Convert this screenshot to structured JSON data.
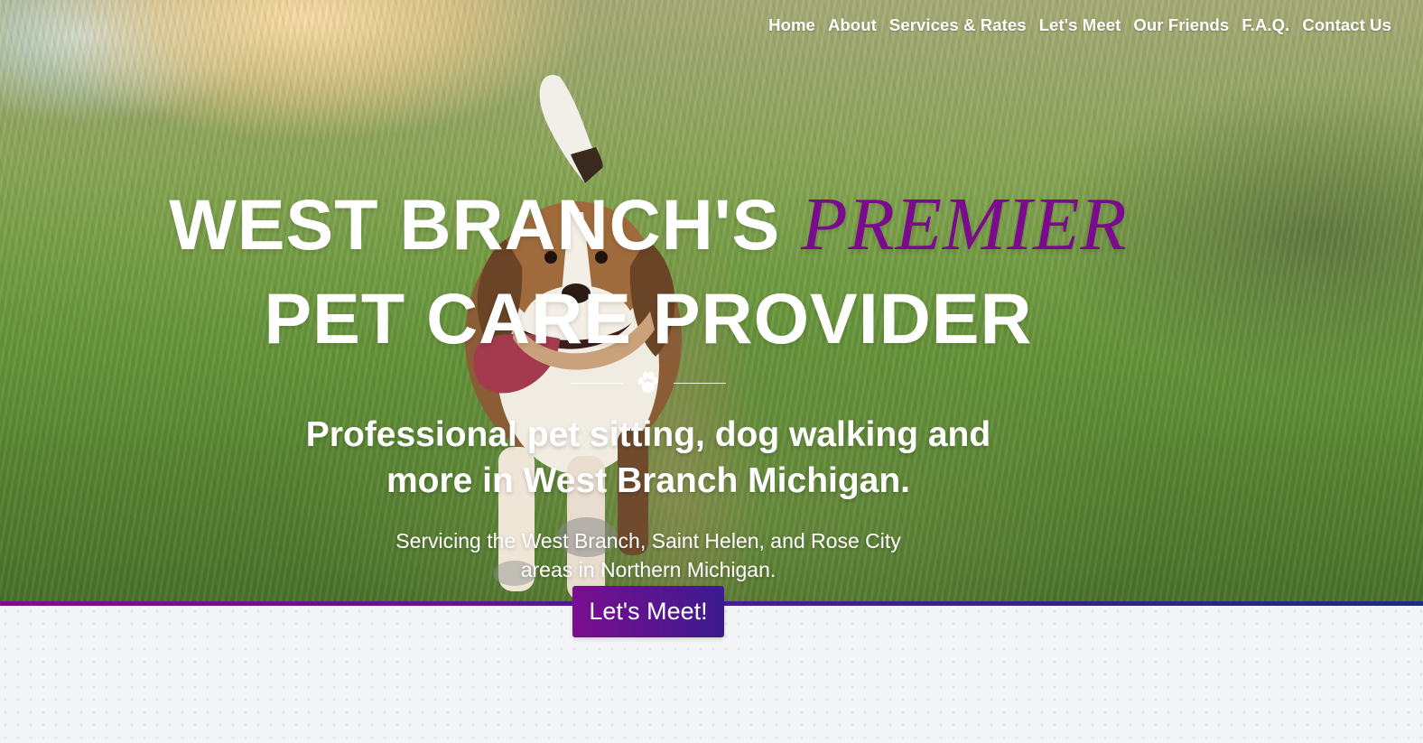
{
  "nav": {
    "items": [
      {
        "label": "Home"
      },
      {
        "label": "About"
      },
      {
        "label": "Services & Rates"
      },
      {
        "label": "Let's Meet"
      },
      {
        "label": "Our Friends"
      },
      {
        "label": "F.A.Q."
      },
      {
        "label": "Contact Us"
      }
    ]
  },
  "hero": {
    "headline_part1": "WEST BRANCH'S ",
    "headline_accent": "PREMIER",
    "headline_part2": "PET CARE PROVIDER",
    "divider_icon": "paw-icon",
    "tagline": "Professional pet sitting, dog walking and more in West Branch Michigan.",
    "service_area": "Servicing the West Branch, Saint Helen, and Rose City areas in Northern Michigan.",
    "cta_label": "Let's Meet!"
  },
  "colors": {
    "accent_purple": "#7a0b8c",
    "border_gradient_start": "#7e0f8f",
    "border_gradient_end": "#1e2b7e",
    "text_white": "#ffffff",
    "lower_background": "#f4f5f6"
  }
}
